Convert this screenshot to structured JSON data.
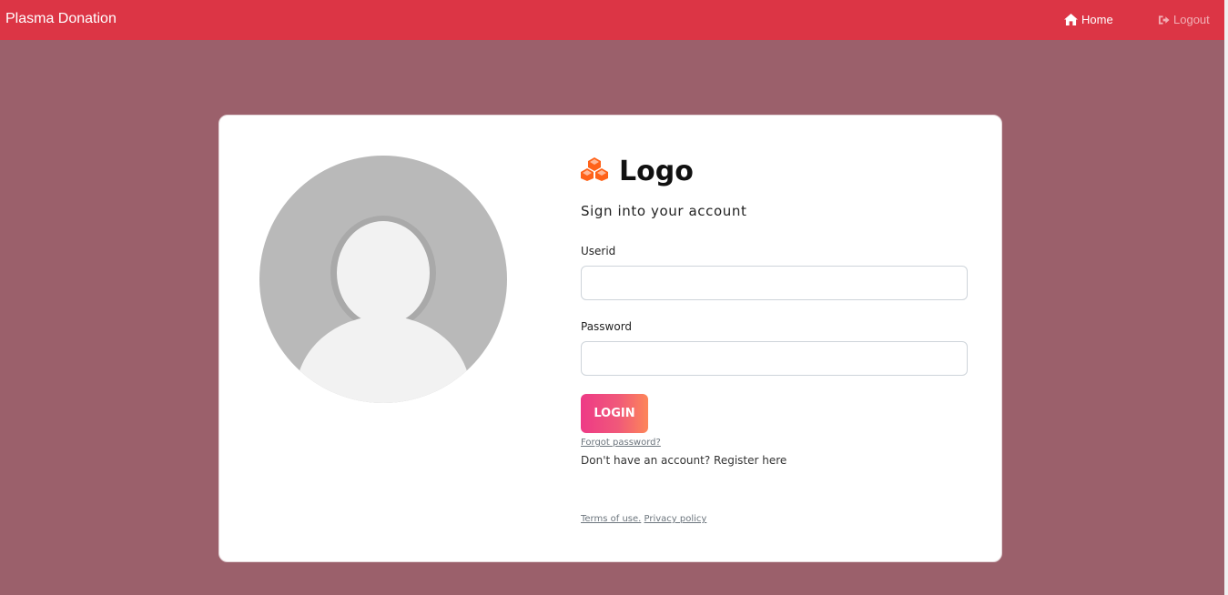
{
  "navbar": {
    "brand": "Plasma Donation",
    "home_label": "Home",
    "logout_label": "Logout",
    "home_icon": "home-icon",
    "logout_icon": "sign-out-icon",
    "background_color": "#dc3545"
  },
  "page": {
    "background_color": "#9b606b"
  },
  "avatar": {
    "icon": "user-placeholder-icon"
  },
  "login_form": {
    "logo_icon": "cubes-icon",
    "logo_color": "#ff6219",
    "logo_text": "Logo",
    "subtitle": "Sign into your account",
    "userid_label": "Userid",
    "userid_value": "",
    "password_label": "Password",
    "password_value": "",
    "login_button": "LOGIN",
    "forgot_password": "Forgot password?",
    "register_text": "Don't have an account? Register here",
    "terms_link": "Terms of use.",
    "privacy_link": "Privacy policy"
  }
}
